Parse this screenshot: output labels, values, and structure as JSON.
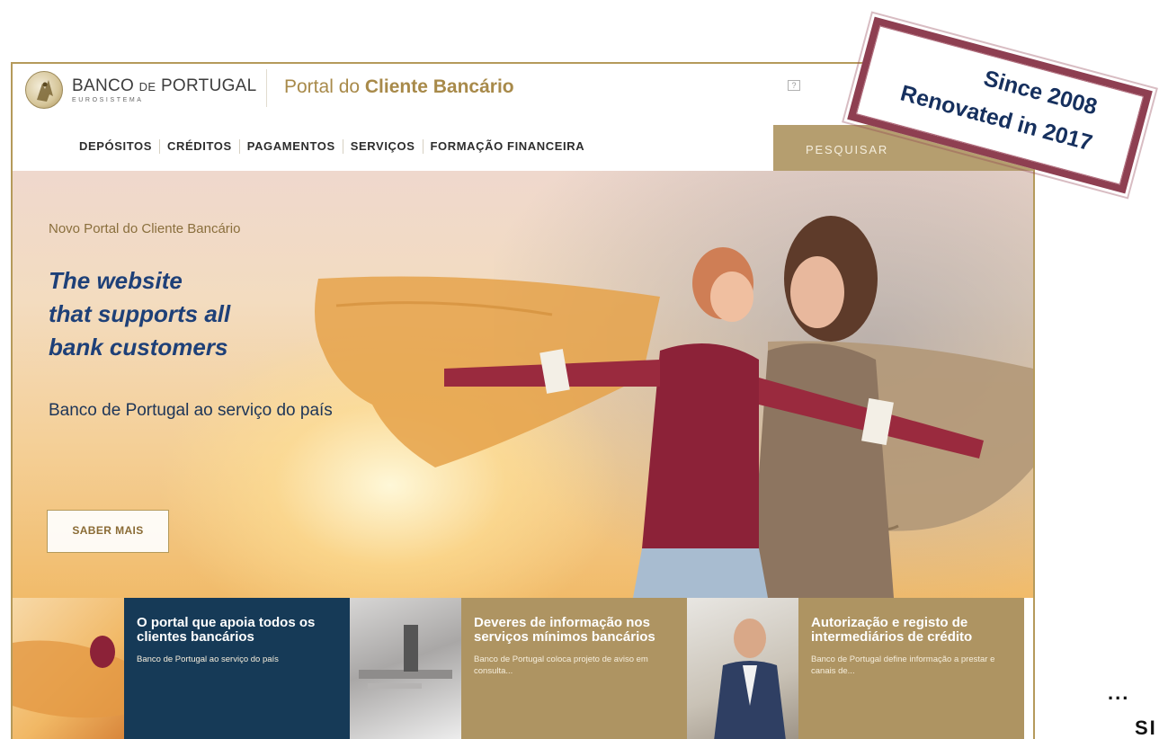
{
  "header": {
    "bank_name_main": "BANCO",
    "bank_name_de": "DE",
    "bank_name_end": "PORTUGAL",
    "bank_sub": "EUROSISTEMA",
    "portal_prefix": "Portal do ",
    "portal_bold": "Cliente Bancário",
    "help_label": "?"
  },
  "nav": {
    "items": [
      {
        "label": "DEPÓSITOS"
      },
      {
        "label": "CRÉDITOS"
      },
      {
        "label": "PAGAMENTOS"
      },
      {
        "label": "SERVIÇOS"
      },
      {
        "label": "FORMAÇÃO FINANCEIRA"
      }
    ],
    "search_label": "PESQUISAR"
  },
  "hero": {
    "kicker": "Novo Portal do Cliente Bancário",
    "headline_1": "The website",
    "headline_2": "that supports all",
    "headline_3": "bank customers",
    "subtitle": "Banco de Portugal ao serviço do país",
    "cta_label": "SABER MAIS"
  },
  "cards": [
    {
      "title": "O portal que apoia todos os clientes bancários",
      "text": "Banco de Portugal ao serviço do país"
    },
    {
      "title": "Deveres de informação nos serviços mínimos bancários",
      "text": "Banco de Portugal coloca projeto de aviso em consulta..."
    },
    {
      "title": "Autorização e registo de intermediários de crédito",
      "text": "Banco de Portugal define informação a prestar e canais de..."
    }
  ],
  "stamp": {
    "line1": "Since 2008",
    "line2": "Renovated in 2017"
  },
  "trailing": {
    "ellipsis": "...",
    "partial": "SI"
  },
  "colors": {
    "gold": "#b59a5b",
    "navy_card": "#163a57",
    "gold_card": "#ae9462",
    "headline": "#1e4078",
    "stamp_border": "#8e3f51"
  }
}
